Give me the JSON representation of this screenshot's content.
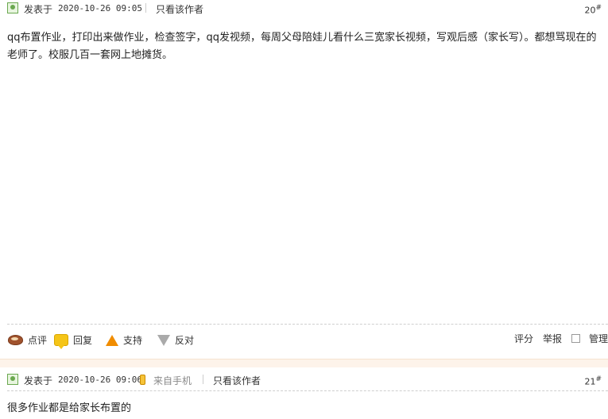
{
  "post1": {
    "posted_label": "发表于",
    "timestamp": "2020-10-26 09:05",
    "only_author": "只看该作者",
    "floor_number": "20",
    "floor_mark": "#",
    "content": "qq布置作业，打印出来做作业，检查签字，qq发视频，每周父母陪娃儿看什么三宽家长视频，写观后感（家长写）。都想骂现在的老师了。校服几百一套网上地摊货。",
    "actions": {
      "comment": "点评",
      "reply": "回复",
      "support": "支持",
      "oppose": "反对"
    },
    "tools": {
      "rate": "评分",
      "report": "举报",
      "manage": "管理"
    }
  },
  "post2": {
    "posted_label": "发表于",
    "timestamp": "2020-10-26 09:06",
    "from_mobile": "来自手机",
    "only_author": "只看该作者",
    "floor_number": "21",
    "floor_mark": "#",
    "content": "很多作业都是给家长布置的"
  },
  "icons": {
    "author": "user-icon",
    "mobile": "phone-icon",
    "comment": "comment-icon",
    "reply": "reply-icon",
    "support": "thumb-up-arrow-icon",
    "oppose": "thumb-down-arrow-icon"
  },
  "colors": {
    "accent_green": "#6aa84f",
    "support_orange": "#f08c00",
    "divider_band": "#fdf3ea"
  }
}
